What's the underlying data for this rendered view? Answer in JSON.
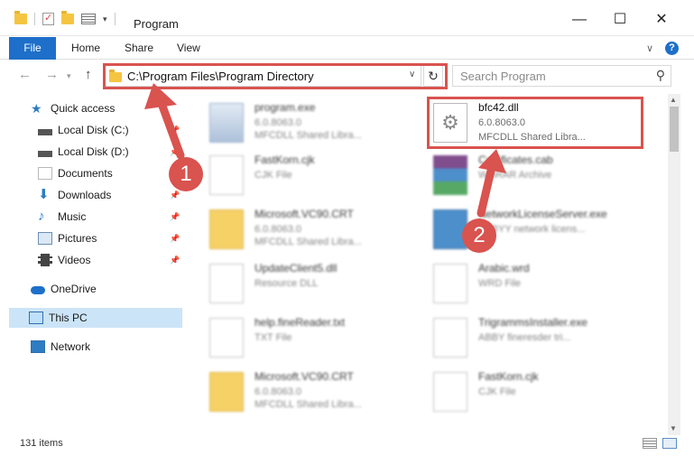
{
  "window": {
    "title": "Program"
  },
  "ribbon": {
    "file": "File",
    "home": "Home",
    "share": "Share",
    "view": "View"
  },
  "address": {
    "path": "C:\\Program Files\\Program Directory"
  },
  "search": {
    "placeholder": "Search Program"
  },
  "sidebar": {
    "quick_access": "Quick access",
    "items": [
      {
        "label": "Local Disk (C:)",
        "pinned": true
      },
      {
        "label": "Local Disk (D:)",
        "pinned": true
      },
      {
        "label": "Documents",
        "pinned": true
      },
      {
        "label": "Downloads",
        "pinned": true
      },
      {
        "label": "Music",
        "pinned": true
      },
      {
        "label": "Pictures",
        "pinned": true
      },
      {
        "label": "Videos",
        "pinned": true
      }
    ],
    "onedrive": "OneDrive",
    "this_pc": "This PC",
    "network": "Network"
  },
  "files": [
    {
      "name": "program.exe",
      "line1": "6.0.8063.0",
      "line2": "MFCDLL Shared Libra...",
      "icon": "app-icon"
    },
    {
      "name": "bfc42.dll",
      "line1": "6.0.8063.0",
      "line2": "MFCDLL Shared Libra...",
      "icon": "dll-gear-icon"
    },
    {
      "name": "FastKorn.cjk",
      "line1": "CJK File",
      "line2": "",
      "icon": "page-icon"
    },
    {
      "name": "Certificates.cab",
      "line1": "WinRAR Archive",
      "line2": "",
      "icon": "winrar-icon"
    },
    {
      "name": "Microsoft.VC90.CRT",
      "line1": "6.0.8063.0",
      "line2": "MFCDLL Shared Libra...",
      "icon": "folder-icon"
    },
    {
      "name": "NetworkLicenseServer.exe",
      "line1": "ABBYY network licens...",
      "line2": "",
      "icon": "network-app-icon"
    },
    {
      "name": "UpdateClient5.dll",
      "line1": "Resource DLL",
      "line2": "",
      "icon": "dll-gear-icon"
    },
    {
      "name": "Arabic.wrd",
      "line1": "WRD File",
      "line2": "",
      "icon": "page-icon"
    },
    {
      "name": "help.fineReader.txt",
      "line1": "TXT File",
      "line2": "",
      "icon": "page-icon"
    },
    {
      "name": "TrigrammsInstaller.exe",
      "line1": "ABBY fineresder tri...",
      "line2": "",
      "icon": "page-icon"
    },
    {
      "name": "Microsoft.VC90.CRT",
      "line1": "6.0.8063.0",
      "line2": "MFCDLL Shared Libra...",
      "icon": "folder-icon"
    },
    {
      "name": "FastKorn.cjk",
      "line1": "CJK File",
      "line2": "",
      "icon": "page-icon"
    }
  ],
  "callouts": {
    "one": "1",
    "two": "2"
  },
  "status": {
    "items": "131 items"
  },
  "colors": {
    "accent": "#1e6fc9",
    "highlight": "#d9534f",
    "selected": "#cce4f7"
  }
}
